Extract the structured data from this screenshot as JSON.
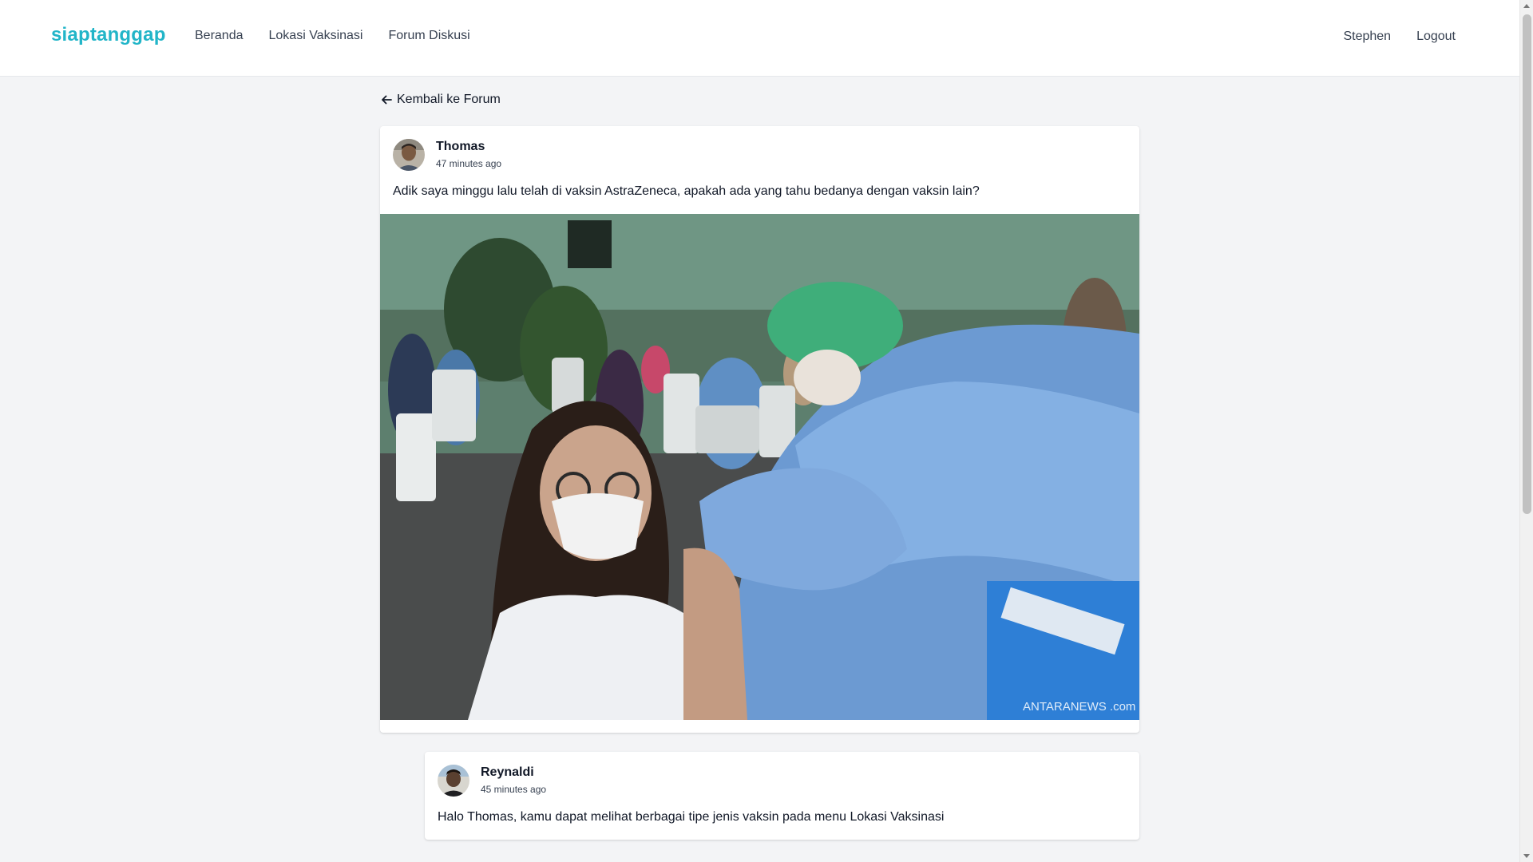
{
  "navbar": {
    "brand": "siaptanggap",
    "links": [
      "Beranda",
      "Lokasi Vaksinasi",
      "Forum Diskusi"
    ],
    "user": "Stephen",
    "logout": "Logout"
  },
  "back_link": {
    "label": "Kembali ke Forum",
    "icon": "arrow-left-icon"
  },
  "post": {
    "author": "Thomas",
    "time": "47 minutes ago",
    "text": "Adik saya minggu lalu telah di vaksin AstraZeneca, apakah ada yang tahu bedanya dengan vaksin lain?",
    "image_watermark": "ANTARANEWS .com"
  },
  "reply": {
    "author": "Reynaldi",
    "time": "45 minutes ago",
    "text": "Halo Thomas, kamu dapat melihat berbagai tipe jenis vaksin pada menu Lokasi Vaksinasi"
  },
  "colors": {
    "brand": "#22b5c8",
    "background": "#f3f4f6",
    "card": "#ffffff"
  }
}
